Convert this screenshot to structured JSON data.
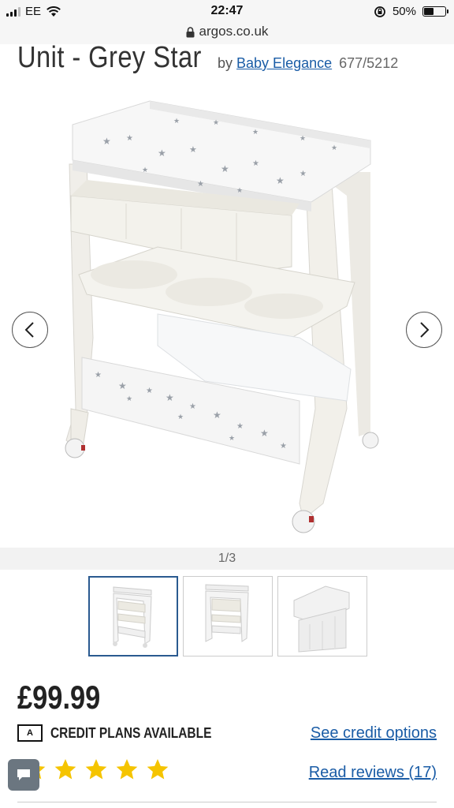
{
  "status_bar": {
    "carrier": "EE",
    "time": "22:47",
    "battery": "50%",
    "battery_level": 0.5
  },
  "browser": {
    "url": "argos.co.uk"
  },
  "product": {
    "title": "Unit - Grey Star",
    "by_prefix": "by",
    "brand": "Baby Elegance",
    "code": "677/5212",
    "image_counter": "1/3",
    "price": "£99.99",
    "credit_plans_label": "CREDIT PLANS AVAILABLE",
    "credit_logo_text": "A",
    "see_credit_options": "See credit options",
    "read_reviews": "Read reviews (17)",
    "rating": 5
  },
  "icons": {
    "prev": "chevron-left-icon",
    "next": "chevron-right-icon",
    "chat": "chat-bubble-icon",
    "lock": "lock-icon"
  },
  "colors": {
    "link": "#1a5ca6",
    "star": "#f5c400",
    "thumb_active_border": "#2a5a90",
    "chat_button": "#6b7680"
  }
}
